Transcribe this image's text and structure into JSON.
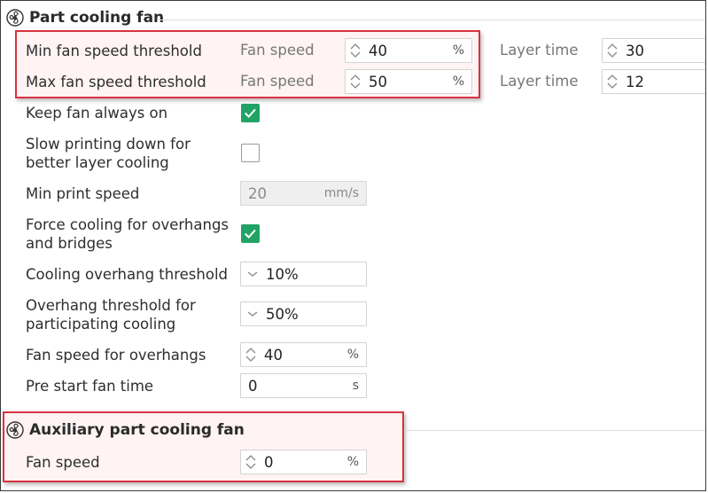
{
  "part_cooling_fan": {
    "title": "Part cooling fan",
    "min_fan_speed_threshold": {
      "label": "Min fan speed threshold",
      "fan_speed_label": "Fan speed",
      "fan_speed_value": "40",
      "fan_speed_unit": "%",
      "layer_time_label": "Layer time",
      "layer_time_value": "30"
    },
    "max_fan_speed_threshold": {
      "label": "Max fan speed threshold",
      "fan_speed_label": "Fan speed",
      "fan_speed_value": "50",
      "fan_speed_unit": "%",
      "layer_time_label": "Layer time",
      "layer_time_value": "12"
    },
    "keep_fan_always_on": {
      "label": "Keep fan always on",
      "checked": true
    },
    "slow_printing_down": {
      "label_line1": "Slow printing down for",
      "label_line2": "better layer cooling",
      "checked": false
    },
    "min_print_speed": {
      "label": "Min print speed",
      "value": "20",
      "unit": "mm/s"
    },
    "force_cooling": {
      "label_line1": "Force cooling for overhangs",
      "label_line2": "and bridges",
      "checked": true
    },
    "cooling_overhang_threshold": {
      "label": "Cooling overhang threshold",
      "value": "10%"
    },
    "overhang_threshold_participating": {
      "label_line1": "Overhang threshold for",
      "label_line2": "participating cooling",
      "value": "50%"
    },
    "fan_speed_for_overhangs": {
      "label": "Fan speed for overhangs",
      "value": "40",
      "unit": "%"
    },
    "pre_start_fan_time": {
      "label": "Pre start fan time",
      "value": "0",
      "unit": "s"
    }
  },
  "auxiliary_part_cooling_fan": {
    "title": "Auxiliary part cooling fan",
    "fan_speed": {
      "label": "Fan speed",
      "value": "0",
      "unit": "%"
    }
  },
  "colors": {
    "accent_check": "#21a366",
    "highlight_border": "#d7333f"
  },
  "icons": {
    "section": "fan-icon",
    "spinner": "spinner-arrows-icon",
    "dropdown": "chevron-down-icon",
    "checkmark": "checkmark-icon"
  }
}
